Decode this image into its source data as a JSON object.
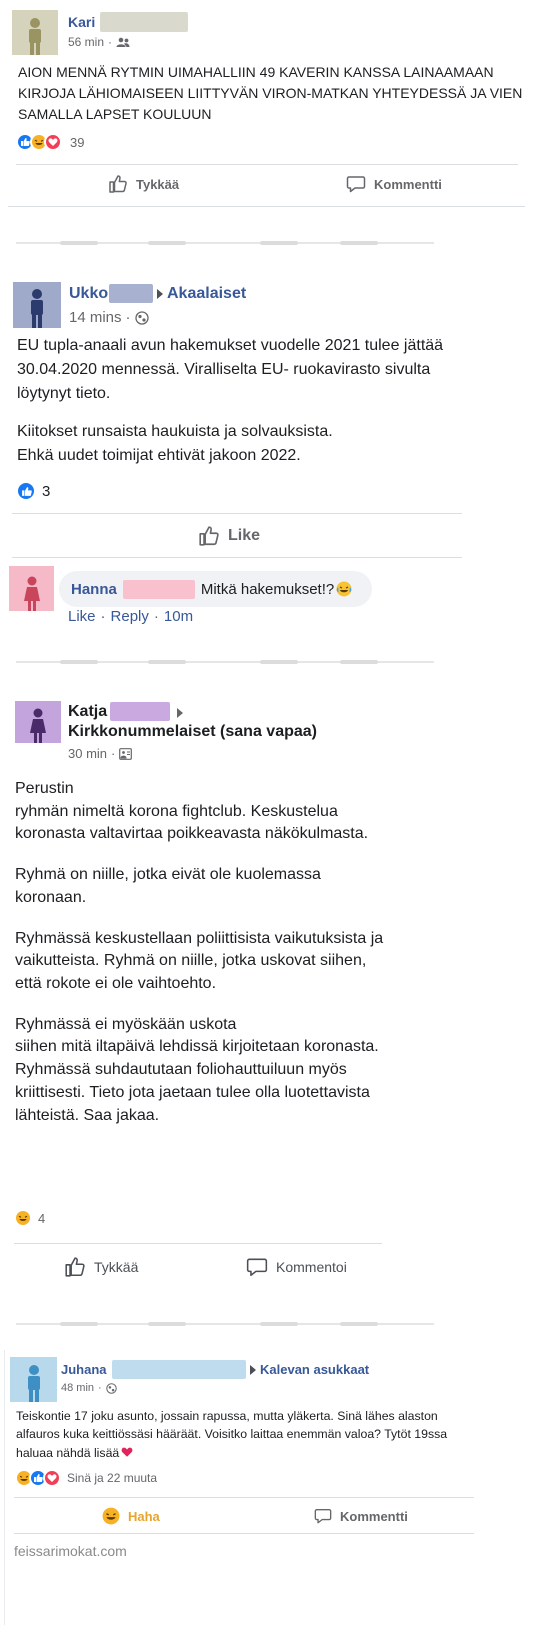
{
  "post1": {
    "author": "Kari",
    "time": "56 min",
    "privacy_icon": "friends-icon",
    "text": "AION MENNÄ RYTMIN UIMAHALLIIN 49 KAVERIN KANSSA LAINAAMAAN KIRJOJA LÄHIOMAISEEN LIITTYVÄN VIRON-MATKAN YHTEYDESSÄ JA VIEN SAMALLA LAPSET KOULUUN",
    "reactions": [
      "like-icon",
      "haha-icon",
      "love-icon"
    ],
    "reaction_count": "39",
    "like_label": "Tykkää",
    "comment_label": "Kommentti"
  },
  "post2": {
    "author": "Ukko",
    "group": "Akaalaiset",
    "time": "14 mins",
    "privacy_icon": "globe-icon",
    "para1": "EU tupla-anaali avun hakemukset vuodelle 2021 tulee jättää 30.04.2020 mennessä. Viralliselta EU- ruokavirasto sivulta löytynyt tieto.",
    "para2": "Kiitokset runsaista haukuista ja solvauksista.\nEhkä uudet toimijat ehtivät jakoon 2022.",
    "reaction_count": "3",
    "like_label": "Like",
    "comment": {
      "author": "Hanna",
      "text": "Mitkä hakemukset!?",
      "like": "Like",
      "reply": "Reply",
      "time": "10m"
    }
  },
  "post3": {
    "author": "Katja",
    "group": "Kirkkonummelaiset (sana vapaa)",
    "time": "30 min",
    "privacy_icon": "group-icon",
    "para1": "Perustin\nryhmän nimeltä korona fightclub.  Keskustelua koronasta valtavirtaa  poikkeavasta näkökulmasta.",
    "para2": "Ryhmä on niille, jotka eivät ole kuolemassa koronaan.",
    "para3": "Ryhmässä keskustellaan poliittisista vaikutuksista ja vaikutteista. Ryhmä on niille, jotka uskovat siihen, että rokote ei ole vaihtoehto.",
    "para4": "Ryhmässä ei myöskään uskota\nsiihen mitä iltapäivä lehdissä kirjoitetaan koronasta. Ryhmässä suhdaututaan foliohauttuiluun myös kriittisesti. Tieto jota jaetaan tulee olla luotettavista lähteistä. Saa jakaa.",
    "reaction_count": "4",
    "like_label": "Tykkää",
    "comment_label": "Kommentoi"
  },
  "post4": {
    "author": "Juhana",
    "group": "Kalevan asukkaat",
    "time": "48 min",
    "privacy_icon": "globe-icon",
    "text": "Teiskontie 17 joku asunto, jossain rapussa, mutta yläkerta. Sinä lähes alaston alfauros kuka keittiössäsi hääräät. Voisitko laittaa enemmän valoa? Tytöt 19ssa haluaa nähdä lisää",
    "reaction_count": "Sinä ja 22 muuta",
    "haha_label": "Haha",
    "comment_label": "Kommentti"
  },
  "watermark": "feissarimokat.com",
  "colors": {
    "facebook_blue": "#1877f2",
    "link_blue": "#385898",
    "haha_yellow": "#e7a52b",
    "love_red": "#f33e58",
    "avatar_kari": "#d6d3bd",
    "avatar_ukko": "#9fa9c9",
    "avatar_hanna": "#f6b9c8",
    "avatar_katja": "#c3a4dc",
    "avatar_juhana": "#b8d8ec"
  }
}
